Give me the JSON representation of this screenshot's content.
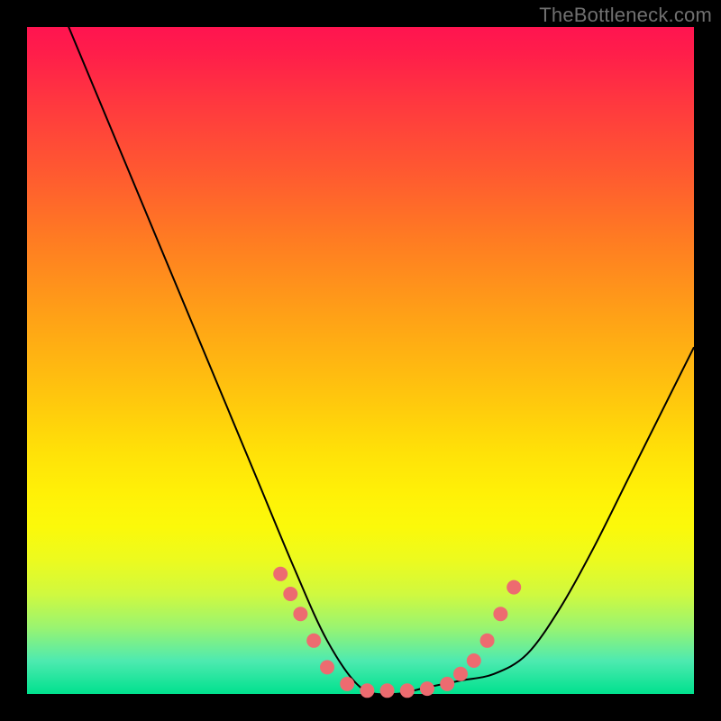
{
  "watermark": "TheBottleneck.com",
  "chart_data": {
    "type": "line",
    "title": "",
    "xlabel": "",
    "ylabel": "",
    "xlim": [
      0,
      100
    ],
    "ylim": [
      0,
      100
    ],
    "grid": false,
    "legend": null,
    "series": [
      {
        "name": "bottleneck-curve",
        "x": [
          0,
          5,
          10,
          15,
          20,
          25,
          30,
          35,
          40,
          45,
          50,
          55,
          60,
          65,
          70,
          75,
          80,
          85,
          90,
          95,
          100
        ],
        "values": [
          115,
          103,
          91,
          79,
          67,
          55,
          43,
          31,
          19,
          8,
          1,
          0,
          1,
          2,
          3,
          6,
          13,
          22,
          32,
          42,
          52
        ]
      }
    ],
    "highlight_points": {
      "name": "optimal-range-dots",
      "x": [
        38,
        39.5,
        41,
        43,
        45,
        48,
        51,
        54,
        57,
        60,
        63,
        65,
        67,
        69,
        71,
        73
      ],
      "values": [
        18,
        15,
        12,
        8,
        4,
        1.5,
        0.5,
        0.5,
        0.5,
        0.8,
        1.5,
        3,
        5,
        8,
        12,
        16
      ]
    },
    "background_gradient": {
      "stops": [
        {
          "pos": 0,
          "color": "#ff1450"
        },
        {
          "pos": 50,
          "color": "#ffc80d"
        },
        {
          "pos": 75,
          "color": "#fbf90a"
        },
        {
          "pos": 100,
          "color": "#00e18e"
        }
      ]
    }
  }
}
